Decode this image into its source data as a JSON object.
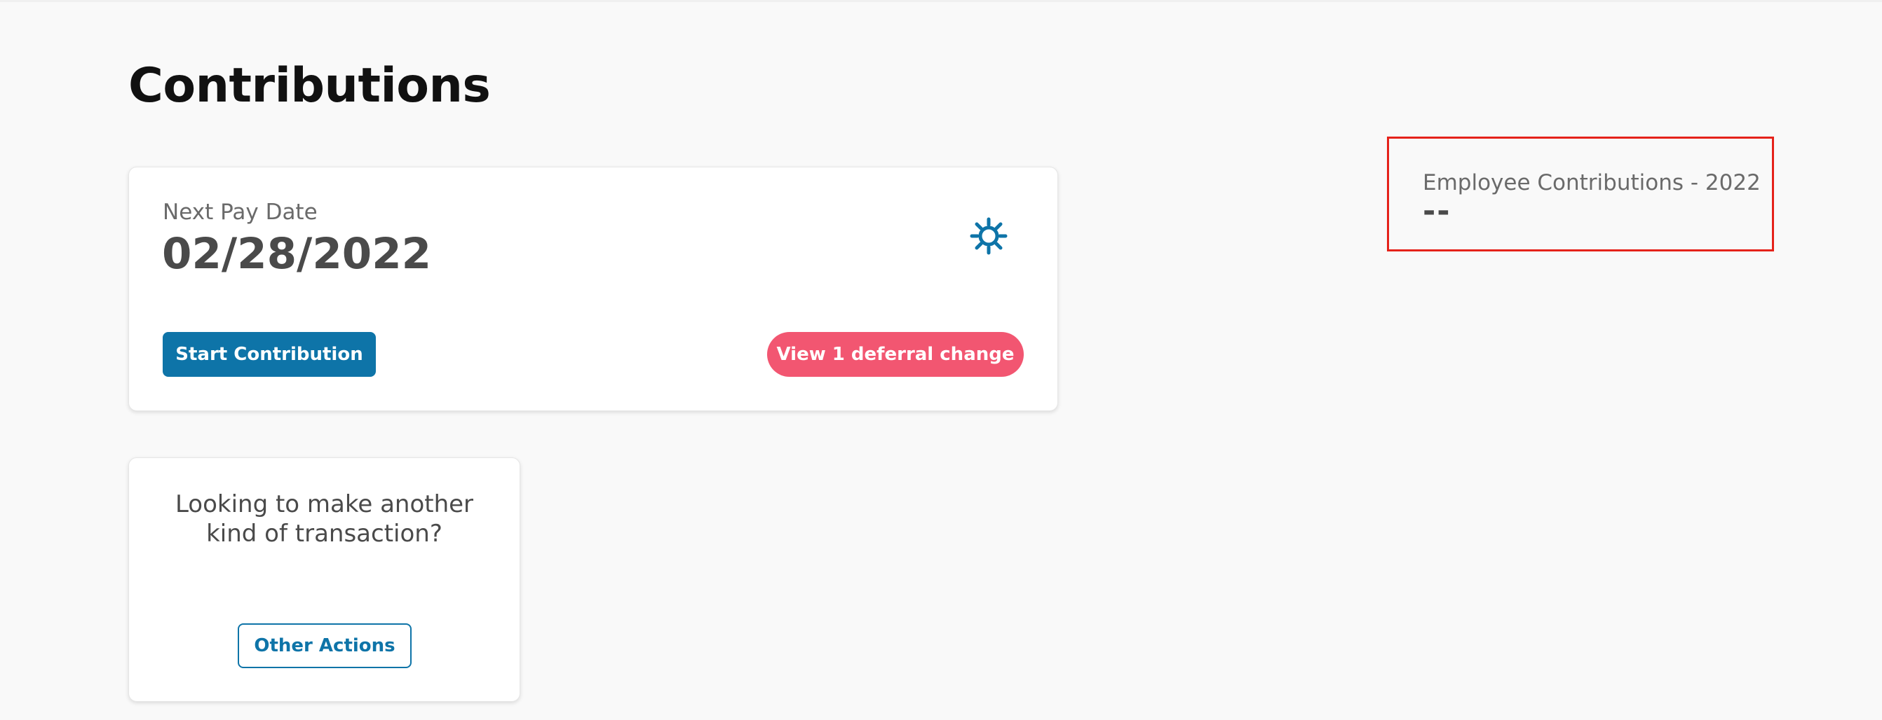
{
  "page": {
    "title": "Contributions"
  },
  "pay_card": {
    "label": "Next Pay Date",
    "date": "02/28/2022",
    "start_button": "Start Contribution",
    "deferral_button": "View 1 deferral change",
    "settings_icon": "gear-icon"
  },
  "other_card": {
    "prompt": "Looking to make another kind of transaction?",
    "button": "Other Actions"
  },
  "employee_contributions": {
    "label": "Employee Contributions - 2022",
    "value": "--"
  },
  "colors": {
    "primary": "#0e74a8",
    "deferral": "#f25671",
    "highlight_border": "#e5221a",
    "background": "#f9f9f9"
  }
}
